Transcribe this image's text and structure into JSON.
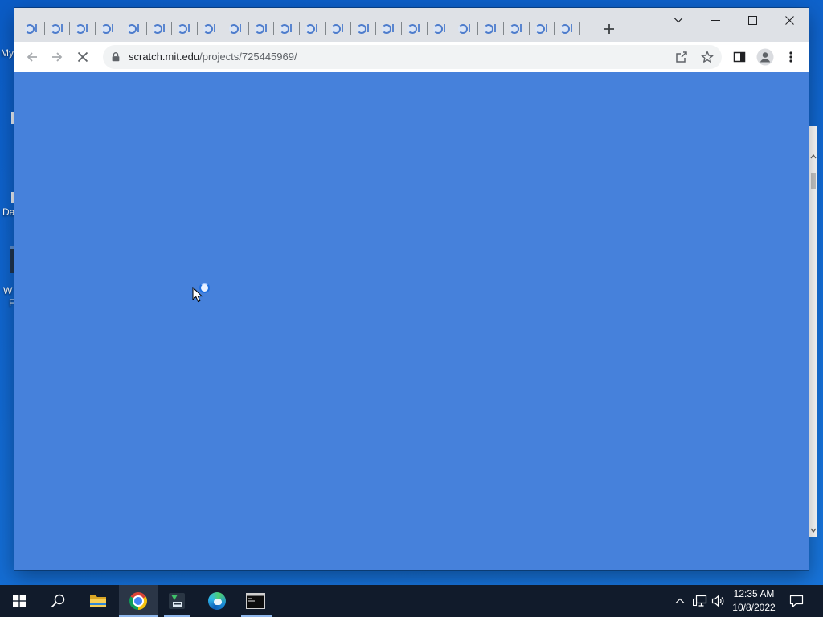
{
  "desktop": {
    "icon_labels": [
      "My",
      "Da",
      "W",
      "F"
    ]
  },
  "browser": {
    "tabs": [
      {
        "icon": "tab-favicon"
      },
      {
        "icon": "tab-favicon"
      },
      {
        "icon": "tab-favicon"
      },
      {
        "icon": "tab-favicon"
      },
      {
        "icon": "tab-favicon"
      },
      {
        "icon": "tab-favicon"
      },
      {
        "icon": "tab-favicon"
      },
      {
        "icon": "tab-favicon"
      },
      {
        "icon": "tab-favicon"
      },
      {
        "icon": "tab-favicon"
      },
      {
        "icon": "tab-favicon"
      },
      {
        "icon": "tab-favicon"
      },
      {
        "icon": "tab-favicon"
      },
      {
        "icon": "tab-favicon"
      },
      {
        "icon": "tab-favicon"
      },
      {
        "icon": "tab-favicon"
      },
      {
        "icon": "tab-favicon"
      },
      {
        "icon": "tab-favicon"
      },
      {
        "icon": "tab-favicon"
      },
      {
        "icon": "tab-favicon"
      },
      {
        "icon": "tab-favicon"
      },
      {
        "icon": "tab-favicon"
      }
    ],
    "url_host": "scratch.mit.edu",
    "url_path": "/projects/725445969/",
    "toolbar_icons": [
      "back-arrow-icon",
      "forward-arrow-icon",
      "stop-loading-icon",
      "lock-icon",
      "share-icon",
      "star-icon",
      "side-panel-icon",
      "profile-icon",
      "menu-icon"
    ]
  },
  "taskbar": {
    "apps": [
      "windows-start-icon",
      "search-icon",
      "file-explorer-icon",
      "chrome-icon",
      "app-icon",
      "edge-icon",
      "terminal-icon"
    ],
    "tray_icons": [
      "chevron-up-icon",
      "network-icon",
      "volume-icon",
      "notification-icon"
    ],
    "clock": {
      "time": "12:35 AM",
      "date": "10/8/2022"
    }
  },
  "colors": {
    "desktop_top": "#0b5cc6",
    "desktop_bottom": "#1874d9",
    "tab_strip": "#dee1e6",
    "toolbar": "#ffffff",
    "omnibox": "#f1f3f4",
    "content": "#4681db",
    "taskbar": "#111b2b",
    "taskbar_highlight": "#2b3647",
    "taskbar_indicator": "#8fb7ec"
  }
}
